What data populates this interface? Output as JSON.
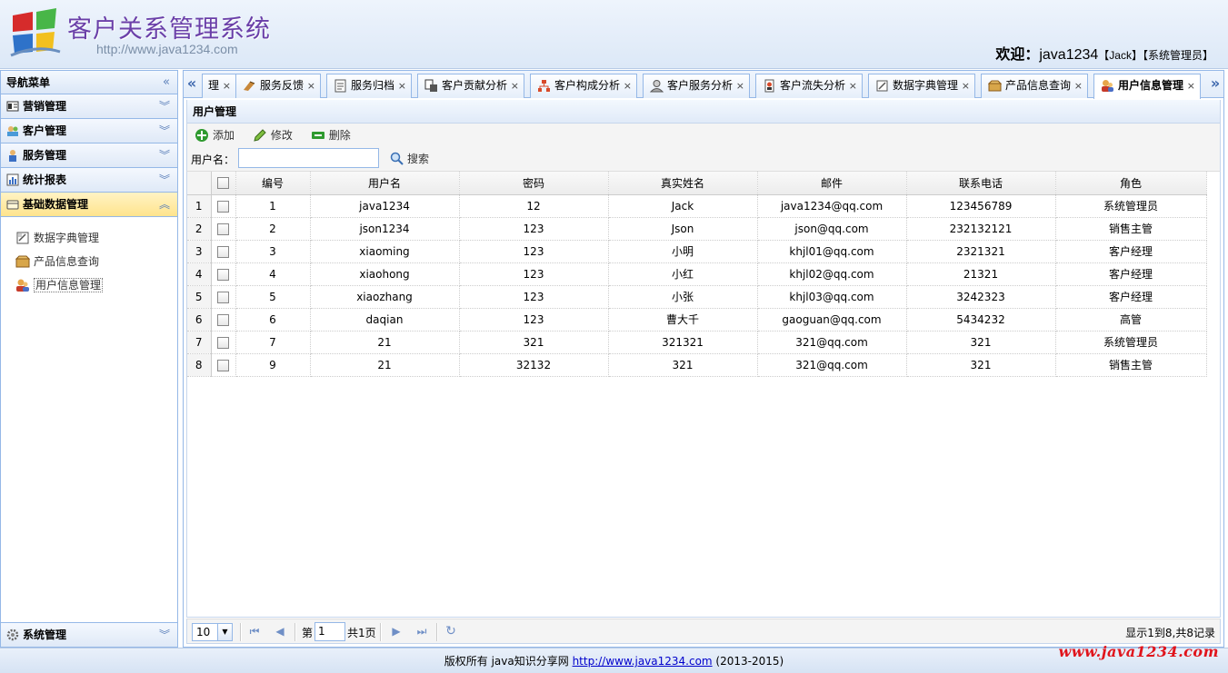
{
  "header": {
    "title": "客户关系管理系统",
    "url": "http://www.java1234.com",
    "welcome_label": "欢迎：",
    "user": "java1234",
    "true_name": "【Jack】",
    "role": "【系统管理员】"
  },
  "nav": {
    "title": "导航菜单",
    "panels": [
      {
        "label": "营销管理",
        "icon": "marketing-icon"
      },
      {
        "label": "客户管理",
        "icon": "customer-icon"
      },
      {
        "label": "服务管理",
        "icon": "service-icon"
      },
      {
        "label": "统计报表",
        "icon": "report-icon"
      },
      {
        "label": "基础数据管理",
        "icon": "basic-data-icon"
      }
    ],
    "items": [
      {
        "label": "数据字典管理",
        "icon": "dictionary-icon"
      },
      {
        "label": "产品信息查询",
        "icon": "product-icon"
      },
      {
        "label": "用户信息管理",
        "icon": "user-icon"
      }
    ],
    "system_panel": "系统管理"
  },
  "tabs": [
    {
      "label": "理"
    },
    {
      "label": "服务反馈"
    },
    {
      "label": "服务归档"
    },
    {
      "label": "客户贡献分析"
    },
    {
      "label": "客户构成分析"
    },
    {
      "label": "客户服务分析"
    },
    {
      "label": "客户流失分析"
    },
    {
      "label": "数据字典管理"
    },
    {
      "label": "产品信息查询"
    },
    {
      "label": "用户信息管理"
    }
  ],
  "panel": {
    "title": "用户管理",
    "toolbar": {
      "add": "添加",
      "edit": "修改",
      "delete": "删除"
    },
    "search": {
      "label": "用户名：",
      "value": "",
      "button": "搜索"
    }
  },
  "grid": {
    "columns": [
      "编号",
      "用户名",
      "密码",
      "真实姓名",
      "邮件",
      "联系电话",
      "角色"
    ],
    "rows": [
      [
        "1",
        "1",
        "java1234",
        "12",
        "Jack",
        "java1234@qq.com",
        "123456789",
        "系统管理员"
      ],
      [
        "2",
        "2",
        "json1234",
        "123",
        "Json",
        "json@qq.com",
        "232132121",
        "销售主管"
      ],
      [
        "3",
        "3",
        "xiaoming",
        "123",
        "小明",
        "khjl01@qq.com",
        "2321321",
        "客户经理"
      ],
      [
        "4",
        "4",
        "xiaohong",
        "123",
        "小红",
        "khjl02@qq.com",
        "21321",
        "客户经理"
      ],
      [
        "5",
        "5",
        "xiaozhang",
        "123",
        "小张",
        "khjl03@qq.com",
        "3242323",
        "客户经理"
      ],
      [
        "6",
        "6",
        "daqian",
        "123",
        "曹大千",
        "gaoguan@qq.com",
        "5434232",
        "高管"
      ],
      [
        "7",
        "7",
        "21",
        "321",
        "321321",
        "321@qq.com",
        "321",
        "系统管理员"
      ],
      [
        "8",
        "9",
        "21",
        "32132",
        "321",
        "321@qq.com",
        "321",
        "销售主管"
      ]
    ]
  },
  "pager": {
    "page_size": "10",
    "page_prefix": "第",
    "page_number": "1",
    "page_suffix": "共1页",
    "info": "显示1到8,共8记录"
  },
  "footer": {
    "prefix": "版权所有 java知识分享网 ",
    "link": "http://www.java1234.com",
    "suffix": " (2013-2015)"
  },
  "watermark": "www.java1234.com"
}
